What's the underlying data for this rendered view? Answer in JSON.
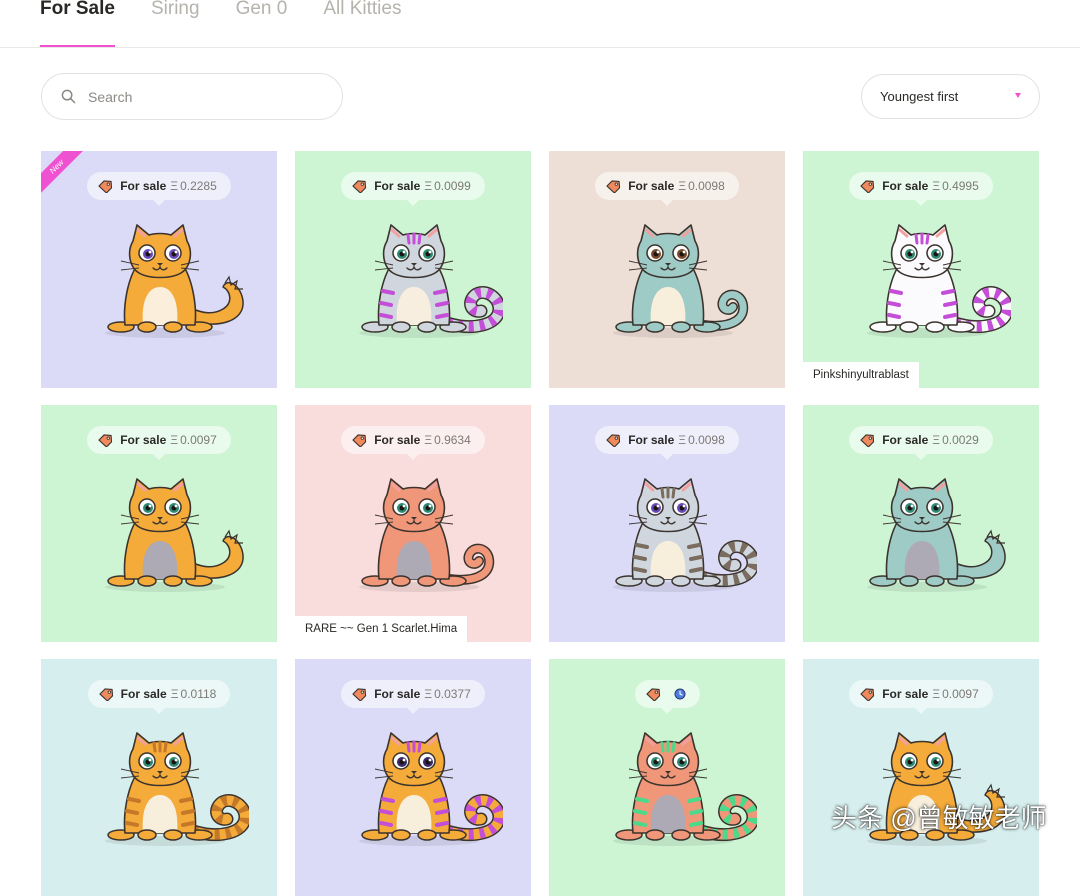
{
  "tabs": [
    {
      "label": "For Sale",
      "active": true
    },
    {
      "label": "Siring",
      "active": false
    },
    {
      "label": "Gen 0",
      "active": false
    },
    {
      "label": "All Kitties",
      "active": false
    }
  ],
  "search": {
    "placeholder": "Search",
    "value": ""
  },
  "sort": {
    "selected": "Youngest first"
  },
  "colors": {
    "accent": "#ef52d1"
  },
  "kitties": [
    {
      "bg": "#dbdbf8",
      "body": "#f4ab3a",
      "belly": "#fbefdc",
      "accent": "#f4ab3a",
      "eye": "#6a4ab8",
      "label": "For sale",
      "eth": "Ξ",
      "price": "0.2285",
      "name": "",
      "ribbon": "New",
      "tail": "fluffy"
    },
    {
      "bg": "#cdf5d4",
      "body": "#d0d6de",
      "belly": "#f7eedf",
      "accent": "#c44ed8",
      "eye": "#2e8a73",
      "label": "For sale",
      "eth": "Ξ",
      "price": "0.0099",
      "name": "",
      "ribbon": "",
      "tail": "stripe"
    },
    {
      "bg": "#eedfd6",
      "body": "#9ecbc6",
      "belly": "#f8eedc",
      "accent": "#9ecbc6",
      "eye": "#7a4a2a",
      "label": "For sale",
      "eth": "Ξ",
      "price": "0.0098",
      "name": "",
      "ribbon": "",
      "tail": "curl"
    },
    {
      "bg": "#cdf5d4",
      "body": "#fbfafd",
      "belly": "#fbfafd",
      "accent": "#c44ed8",
      "eye": "#2e8a73",
      "label": "For sale",
      "eth": "Ξ",
      "price": "0.4995",
      "name": "Pinkshinyultrablast",
      "ribbon": "",
      "tail": "stripe"
    },
    {
      "bg": "#cdf5d4",
      "body": "#f4ab3a",
      "belly": "#aeaab5",
      "accent": "#f4ab3a",
      "eye": "#2e8a73",
      "label": "For sale",
      "eth": "Ξ",
      "price": "0.0097",
      "name": "",
      "ribbon": "",
      "tail": "fluffy"
    },
    {
      "bg": "#f9dcdc",
      "body": "#f0977a",
      "belly": "#aeaab5",
      "accent": "#f0977a",
      "eye": "#2e8a73",
      "label": "For sale",
      "eth": "Ξ",
      "price": "0.9634",
      "name": "RARE ~~ Gen 1 Scarlet.Hima",
      "ribbon": "",
      "tail": "curl"
    },
    {
      "bg": "#dbdbf8",
      "body": "#d0d6de",
      "belly": "#f8eedc",
      "accent": "#7a6c5e",
      "eye": "#6a4ab8",
      "label": "For sale",
      "eth": "Ξ",
      "price": "0.0098",
      "name": "",
      "ribbon": "",
      "tail": "stripe"
    },
    {
      "bg": "#cdf5d4",
      "body": "#9ecbc6",
      "belly": "#aeaab5",
      "accent": "#9ecbc6",
      "eye": "#2e8a73",
      "label": "For sale",
      "eth": "Ξ",
      "price": "0.0029",
      "name": "",
      "ribbon": "",
      "tail": "fluffy"
    },
    {
      "bg": "#d6efee",
      "body": "#f4ab3a",
      "belly": "#f8eedc",
      "accent": "#c4782a",
      "eye": "#2e8a73",
      "label": "For sale",
      "eth": "Ξ",
      "price": "0.0118",
      "name": "",
      "ribbon": "",
      "tail": "stripe"
    },
    {
      "bg": "#dbdbf8",
      "body": "#f4ab3a",
      "belly": "#f8eedc",
      "accent": "#c44ed8",
      "eye": "#3a2a6a",
      "label": "For sale",
      "eth": "Ξ",
      "price": "0.0377",
      "name": "",
      "ribbon": "",
      "tail": "stripe"
    },
    {
      "bg": "#cdf5d4",
      "body": "#f0977a",
      "belly": "#aeaab5",
      "accent": "#4cd98a",
      "eye": "#2e8a73",
      "label": "",
      "eth": "",
      "price": "",
      "name": "",
      "ribbon": "",
      "tail": "stripe",
      "clock": true
    },
    {
      "bg": "#d6efee",
      "body": "#f4ab3a",
      "belly": "#f8eedc",
      "accent": "#f4ab3a",
      "eye": "#2e8a73",
      "label": "For sale",
      "eth": "Ξ",
      "price": "0.0097",
      "name": "",
      "ribbon": "",
      "tail": "fluffy"
    }
  ],
  "watermark": "头条 @曾敏敏老师"
}
